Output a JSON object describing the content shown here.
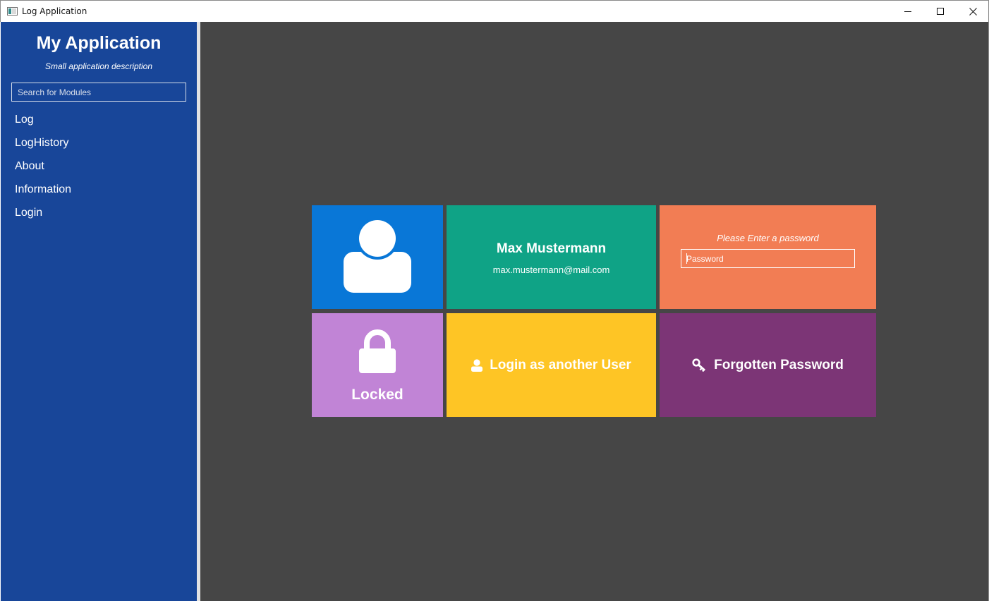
{
  "window": {
    "title": "Log Application",
    "minimize_icon": "minimize-icon",
    "maximize_icon": "maximize-icon",
    "close_icon": "close-icon"
  },
  "sidebar": {
    "title": "My Application",
    "description": "Small application description",
    "search_placeholder": "Search for Modules",
    "items": [
      {
        "label": "Log"
      },
      {
        "label": "LogHistory"
      },
      {
        "label": "About"
      },
      {
        "label": "Information"
      },
      {
        "label": "Login"
      }
    ]
  },
  "login": {
    "avatar_icon": "user-avatar-icon",
    "user": {
      "name": "Max Mustermann",
      "email": "max.mustermann@mail.com"
    },
    "password": {
      "prompt": "Please Enter a password",
      "placeholder": "Password",
      "value": ""
    },
    "locked": {
      "label": "Locked",
      "icon": "lock-icon"
    },
    "login_other": {
      "label": "Login as another User",
      "icon": "user-icon"
    },
    "forgot": {
      "label": "Forgotten Password",
      "icon": "key-icon"
    }
  },
  "colors": {
    "sidebar": "#184699",
    "main_background": "#464646",
    "avatar_tile": "#0977d7",
    "user_tile": "#0fa386",
    "password_tile": "#f27d54",
    "locked_tile": "#c184d6",
    "login_other_tile": "#fec525",
    "forgot_tile": "#7c3576"
  }
}
